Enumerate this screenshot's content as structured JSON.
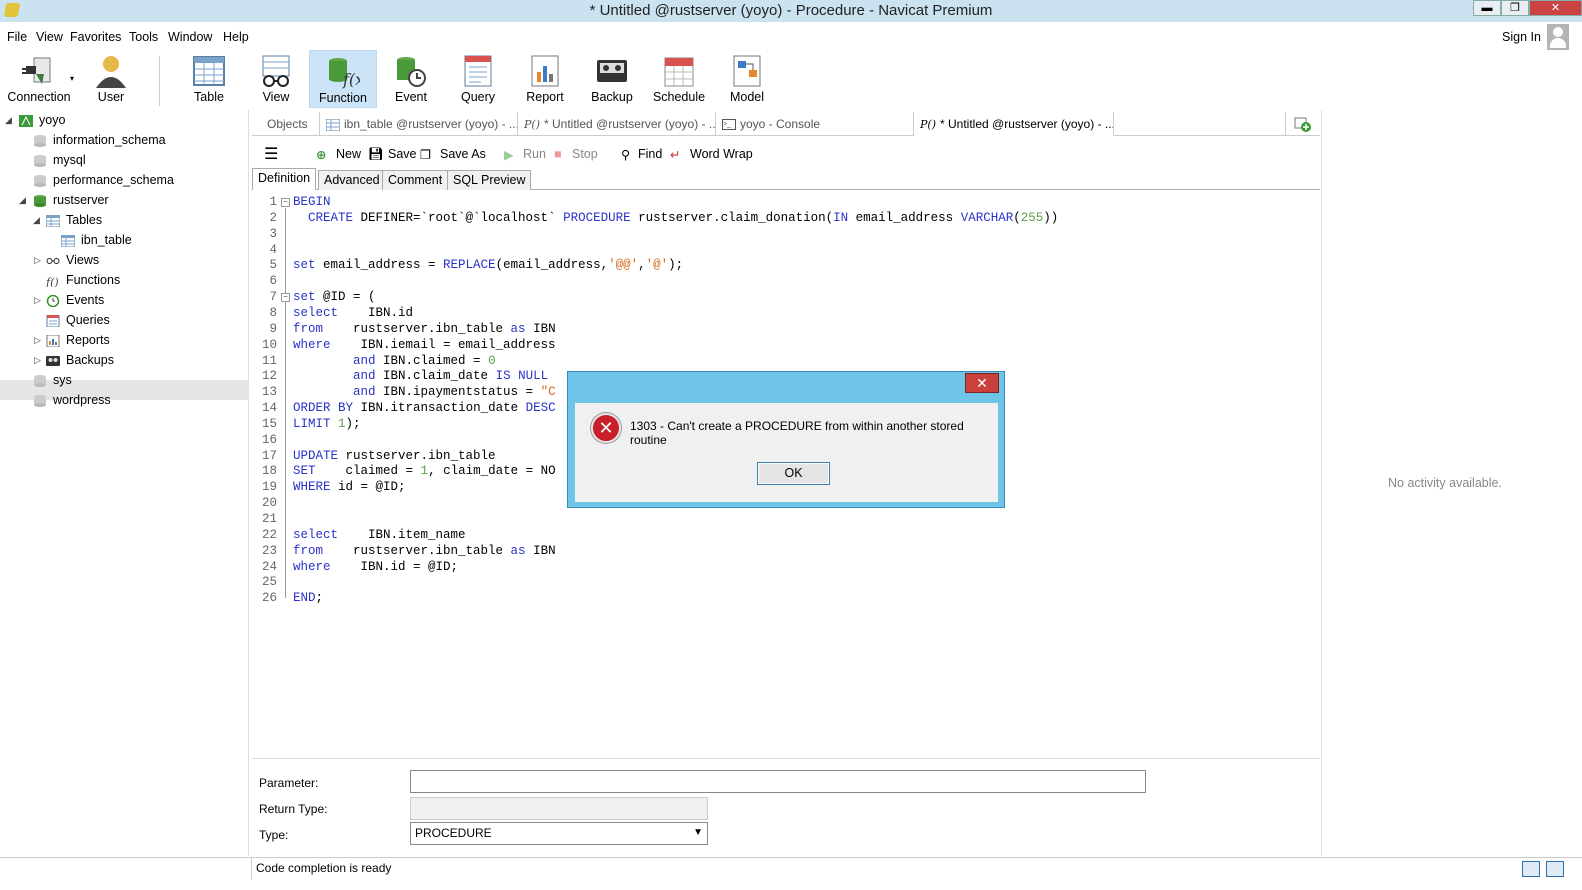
{
  "window": {
    "title": "* Untitled @rustserver (yoyo) - Procedure - Navicat Premium",
    "min": "▬",
    "max": "❐",
    "close": "✕"
  },
  "menu": {
    "items": [
      "File",
      "View",
      "Favorites",
      "Tools",
      "Window",
      "Help"
    ],
    "signin": "Sign In"
  },
  "toolbar": {
    "items": [
      "Connection",
      "User",
      "Table",
      "View",
      "Function",
      "Event",
      "Query",
      "Report",
      "Backup",
      "Schedule",
      "Model"
    ],
    "active": "Function"
  },
  "tree": {
    "items": [
      "yoyo",
      "information_schema",
      "mysql",
      "performance_schema",
      "rustserver",
      "Tables",
      "ibn_table",
      "Views",
      "Functions",
      "Events",
      "Queries",
      "Reports",
      "Backups",
      "sys",
      "wordpress"
    ]
  },
  "tabs": {
    "items": [
      "Objects",
      "ibn_table @rustserver (yoyo) - ...",
      "* Untitled @rustserver (yoyo) - ...",
      "yoyo - Console",
      "* Untitled @rustserver (yoyo) - ..."
    ]
  },
  "editor_toolbar": {
    "new": "New",
    "save": "Save",
    "save_as": "Save As",
    "run": "Run",
    "stop": "Stop",
    "find": "Find",
    "word_wrap": "Word Wrap"
  },
  "subtabs": {
    "items": [
      "Definition",
      "Advanced",
      "Comment",
      "SQL Preview"
    ]
  },
  "code": {
    "lines": [
      "BEGIN",
      "  CREATE DEFINER=`root`@`localhost` PROCEDURE rustserver.claim_donation(IN email_address VARCHAR(255))",
      "",
      "",
      "set email_address = REPLACE(email_address,'@@','@');",
      "",
      "set @ID = (",
      "select    IBN.id",
      "from    rustserver.ibn_table as IBN",
      "where    IBN.iemail = email_address",
      "        and IBN.claimed = 0",
      "        and IBN.claim_date IS NULL",
      "        and IBN.ipaymentstatus = \"C",
      "ORDER BY IBN.itransaction_date DESC",
      "LIMIT 1);",
      "",
      "UPDATE rustserver.ibn_table",
      "SET    claimed = 1, claim_date = NO",
      "WHERE id = @ID;",
      "",
      "",
      "select    IBN.item_name",
      "from    rustserver.ibn_table as IBN",
      "where    IBN.id = @ID;",
      "",
      "END;"
    ]
  },
  "fields": {
    "parameter_label": "Parameter:",
    "parameter_value": "",
    "return_type_label": "Return Type:",
    "return_type_value": "",
    "type_label": "Type:",
    "type_value": "PROCEDURE"
  },
  "right_panel": {
    "message": "No activity available."
  },
  "status": {
    "text": "Code completion is ready"
  },
  "dialog": {
    "message": "1303 - Can't create a PROCEDURE from within another stored routine",
    "ok": "OK",
    "close": "✕",
    "icon": "✕"
  },
  "colors": {
    "keyword": "#2a32c8",
    "number": "#5a9e4a",
    "string": "#d2691e",
    "dialog_frame": "#6fc5e8",
    "error": "#c8202a"
  }
}
